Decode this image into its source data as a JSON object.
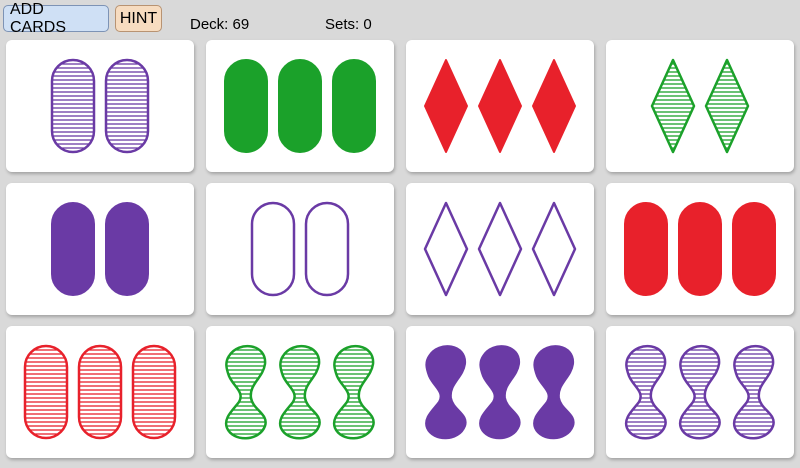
{
  "toolbar": {
    "add_cards_label": "ADD CARDS",
    "hint_label": "HINT",
    "deck_label": "Deck: 69",
    "sets_label": "Sets: 0"
  },
  "colors": {
    "purple": "#6a3aa5",
    "green": "#1ba12a",
    "red": "#e8212b",
    "background": "#d9d9d9",
    "card": "#ffffff"
  },
  "cards": [
    {
      "count": 2,
      "shape": "oval",
      "color": "purple",
      "fill": "striped"
    },
    {
      "count": 3,
      "shape": "oval",
      "color": "green",
      "fill": "solid"
    },
    {
      "count": 3,
      "shape": "diamond",
      "color": "red",
      "fill": "solid"
    },
    {
      "count": 2,
      "shape": "diamond",
      "color": "green",
      "fill": "striped"
    },
    {
      "count": 2,
      "shape": "oval",
      "color": "purple",
      "fill": "solid"
    },
    {
      "count": 2,
      "shape": "oval",
      "color": "purple",
      "fill": "empty"
    },
    {
      "count": 3,
      "shape": "diamond",
      "color": "purple",
      "fill": "empty"
    },
    {
      "count": 3,
      "shape": "oval",
      "color": "red",
      "fill": "solid"
    },
    {
      "count": 3,
      "shape": "oval",
      "color": "red",
      "fill": "striped"
    },
    {
      "count": 3,
      "shape": "squiggle",
      "color": "green",
      "fill": "striped"
    },
    {
      "count": 3,
      "shape": "squiggle",
      "color": "purple",
      "fill": "solid"
    },
    {
      "count": 3,
      "shape": "squiggle",
      "color": "purple",
      "fill": "striped"
    }
  ]
}
